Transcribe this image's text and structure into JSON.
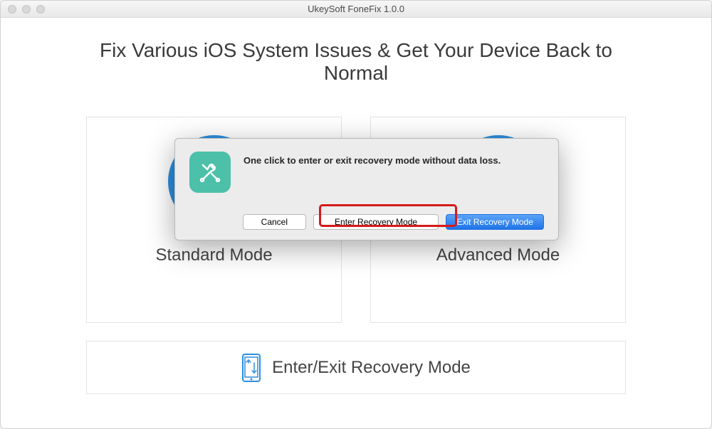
{
  "window": {
    "title": "UkeySoft FoneFix 1.0.0"
  },
  "headline": "Fix Various iOS System Issues & Get Your Device Back to Normal",
  "modes": {
    "standard": "Standard Mode",
    "advanced": "Advanced Mode"
  },
  "recovery_bar": {
    "label": "Enter/Exit Recovery Mode"
  },
  "modal": {
    "message": "One click to enter or exit recovery mode without data loss.",
    "buttons": {
      "cancel": "Cancel",
      "enter": "Enter Recovery Mode",
      "exit": "Exit Recovery Mode"
    }
  },
  "icons": {
    "tools": "tools-icon",
    "phone": "phone-arrows-icon"
  },
  "colors": {
    "accent_blue": "#2c8ee0",
    "button_blue": "#1f74e9",
    "modal_icon_bg": "#4cc0a9",
    "highlight_red": "#d61a1a"
  }
}
